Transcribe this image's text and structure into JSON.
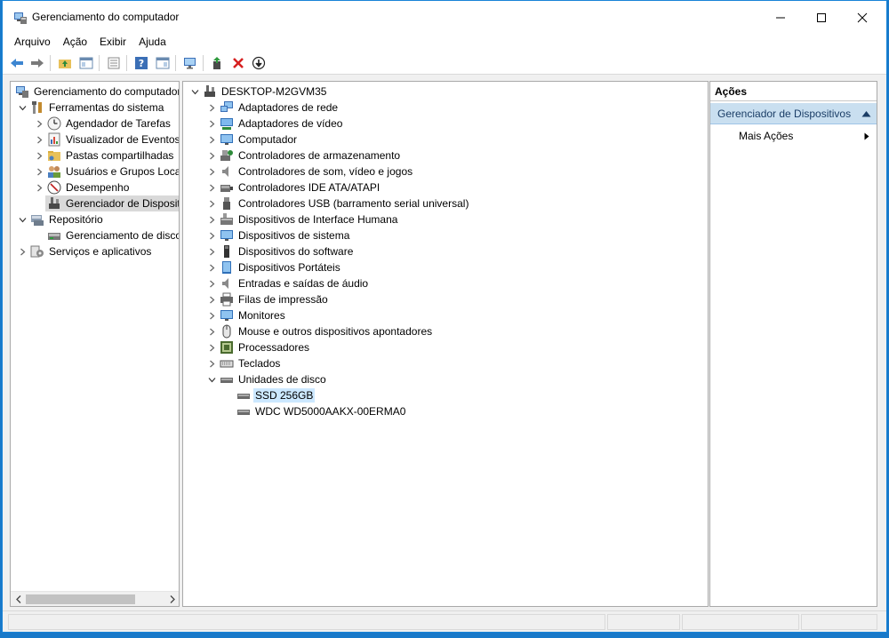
{
  "window": {
    "title": "Gerenciamento do computador"
  },
  "menu": [
    "Arquivo",
    "Ação",
    "Exibir",
    "Ajuda"
  ],
  "left_tree": [
    {
      "label": "Gerenciamento do computador",
      "icon": "computer-management-icon"
    },
    {
      "label": "Ferramentas do sistema",
      "icon": "tools-icon"
    },
    {
      "label": "Agendador de Tarefas",
      "icon": "clock-icon"
    },
    {
      "label": "Visualizador de Eventos",
      "icon": "event-viewer-icon"
    },
    {
      "label": "Pastas compartilhadas",
      "icon": "shared-folder-icon"
    },
    {
      "label": "Usuários e Grupos Loca",
      "icon": "users-icon"
    },
    {
      "label": "Desempenho",
      "icon": "performance-icon"
    },
    {
      "label": "Gerenciador de Disposit",
      "icon": "device-manager-icon"
    },
    {
      "label": "Repositório",
      "icon": "storage-icon"
    },
    {
      "label": "Gerenciamento de disco",
      "icon": "disk-management-icon"
    },
    {
      "label": "Serviços e aplicativos",
      "icon": "services-icon"
    }
  ],
  "device_tree": {
    "root": "DESKTOP-M2GVM35",
    "categories": [
      "Adaptadores de rede",
      "Adaptadores de vídeo",
      "Computador",
      "Controladores de armazenamento",
      "Controladores de som, vídeo e jogos",
      "Controladores IDE ATA/ATAPI",
      "Controladores USB (barramento serial universal)",
      "Dispositivos de Interface Humana",
      "Dispositivos de sistema",
      "Dispositivos do software",
      "Dispositivos Portáteis",
      "Entradas e saídas de áudio",
      "Filas de impressão",
      "Monitores",
      "Mouse e outros dispositivos apontadores",
      "Processadores",
      "Teclados",
      "Unidades de disco"
    ],
    "disk_children": [
      "SSD 256GB",
      "WDC WD5000AAKX-00ERMA0"
    ]
  },
  "actions": {
    "header": "Ações",
    "section": "Gerenciador de Dispositivos",
    "item": "Mais Ações"
  },
  "colors": {
    "accent": "#1883d7",
    "selection": "#cce8ff",
    "section": "#c9dff0"
  }
}
